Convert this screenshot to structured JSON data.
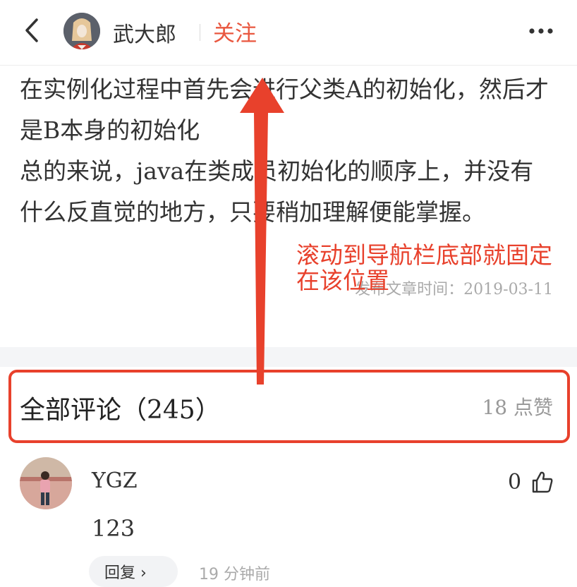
{
  "header": {
    "author_name": "武大郎",
    "follow_label": "关注"
  },
  "article": {
    "paragraphs": [
      "在实例化过程中首先会进行父类A的初始化，然后才是B本身的初始化",
      "总的来说，java在类成员初始化的顺序上，并没有什么反直觉的地方，只要稍加理解便能掌握。"
    ],
    "publish_time": "发布文章时间：2019-03-11"
  },
  "comments": {
    "title": "全部评论（245）",
    "like_summary": "18 点赞",
    "items": [
      {
        "user": "YGZ",
        "text": "123",
        "likes": "0",
        "reply_label": "回复 ›",
        "time": "19 分钟前"
      }
    ]
  },
  "annotation": {
    "text": "滚动到导航栏底部就固定\n在该位置",
    "color": "#e8412c"
  },
  "colors": {
    "accent": "#e9573f",
    "muted": "#aaaaaa",
    "section_bg": "#f4f5f7"
  },
  "icons": [
    "back-icon",
    "more-icon",
    "thumbs-up-icon"
  ]
}
